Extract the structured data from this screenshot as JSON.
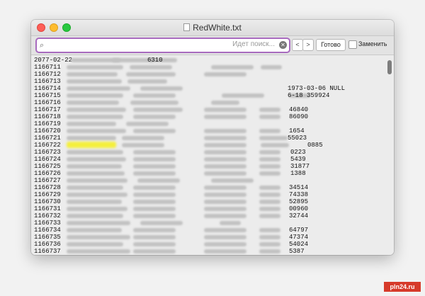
{
  "window": {
    "title": "RedWhite.txt"
  },
  "findbar": {
    "placeholder": "",
    "status": "Идет поиск...",
    "prev_label": "<",
    "next_label": ">",
    "done_label": "Готово",
    "replace_label": "Заменить"
  },
  "lines": [
    {
      "id": "2077-02-22",
      "tail": "6310"
    },
    {
      "id": "1166711",
      "tail": ""
    },
    {
      "id": "1166712",
      "tail": ""
    },
    {
      "id": "1166713",
      "tail": ""
    },
    {
      "id": "1166714",
      "tail": "1973-03-06    NULL"
    },
    {
      "id": "1166715",
      "tail": "6-18        359924"
    },
    {
      "id": "1166716",
      "tail": ""
    },
    {
      "id": "1166717",
      "tail": "46840"
    },
    {
      "id": "1166718",
      "tail": "86090"
    },
    {
      "id": "1166719",
      "tail": ""
    },
    {
      "id": "1166720",
      "tail": "1654"
    },
    {
      "id": "1166721",
      "tail": "55023"
    },
    {
      "id": "1166722",
      "tail": "0885"
    },
    {
      "id": "1166723",
      "tail": "0223"
    },
    {
      "id": "1166724",
      "tail": "5439"
    },
    {
      "id": "1166725",
      "tail": "31877"
    },
    {
      "id": "1166726",
      "tail": "1388"
    },
    {
      "id": "1166727",
      "tail": ""
    },
    {
      "id": "1166728",
      "tail": "34514"
    },
    {
      "id": "1166729",
      "tail": "74338"
    },
    {
      "id": "1166730",
      "tail": "52895"
    },
    {
      "id": "1166731",
      "tail": "00960"
    },
    {
      "id": "1166732",
      "tail": "32744"
    },
    {
      "id": "1166733",
      "tail": ""
    },
    {
      "id": "1166734",
      "tail": "64797"
    },
    {
      "id": "1166735",
      "tail": "47374"
    },
    {
      "id": "1166736",
      "tail": "54024"
    },
    {
      "id": "1166737",
      "tail": "5387"
    }
  ],
  "watermark": "pln24.ru",
  "colors": {
    "search_border": "#a86bbf",
    "highlight": "#f4ef3c"
  }
}
